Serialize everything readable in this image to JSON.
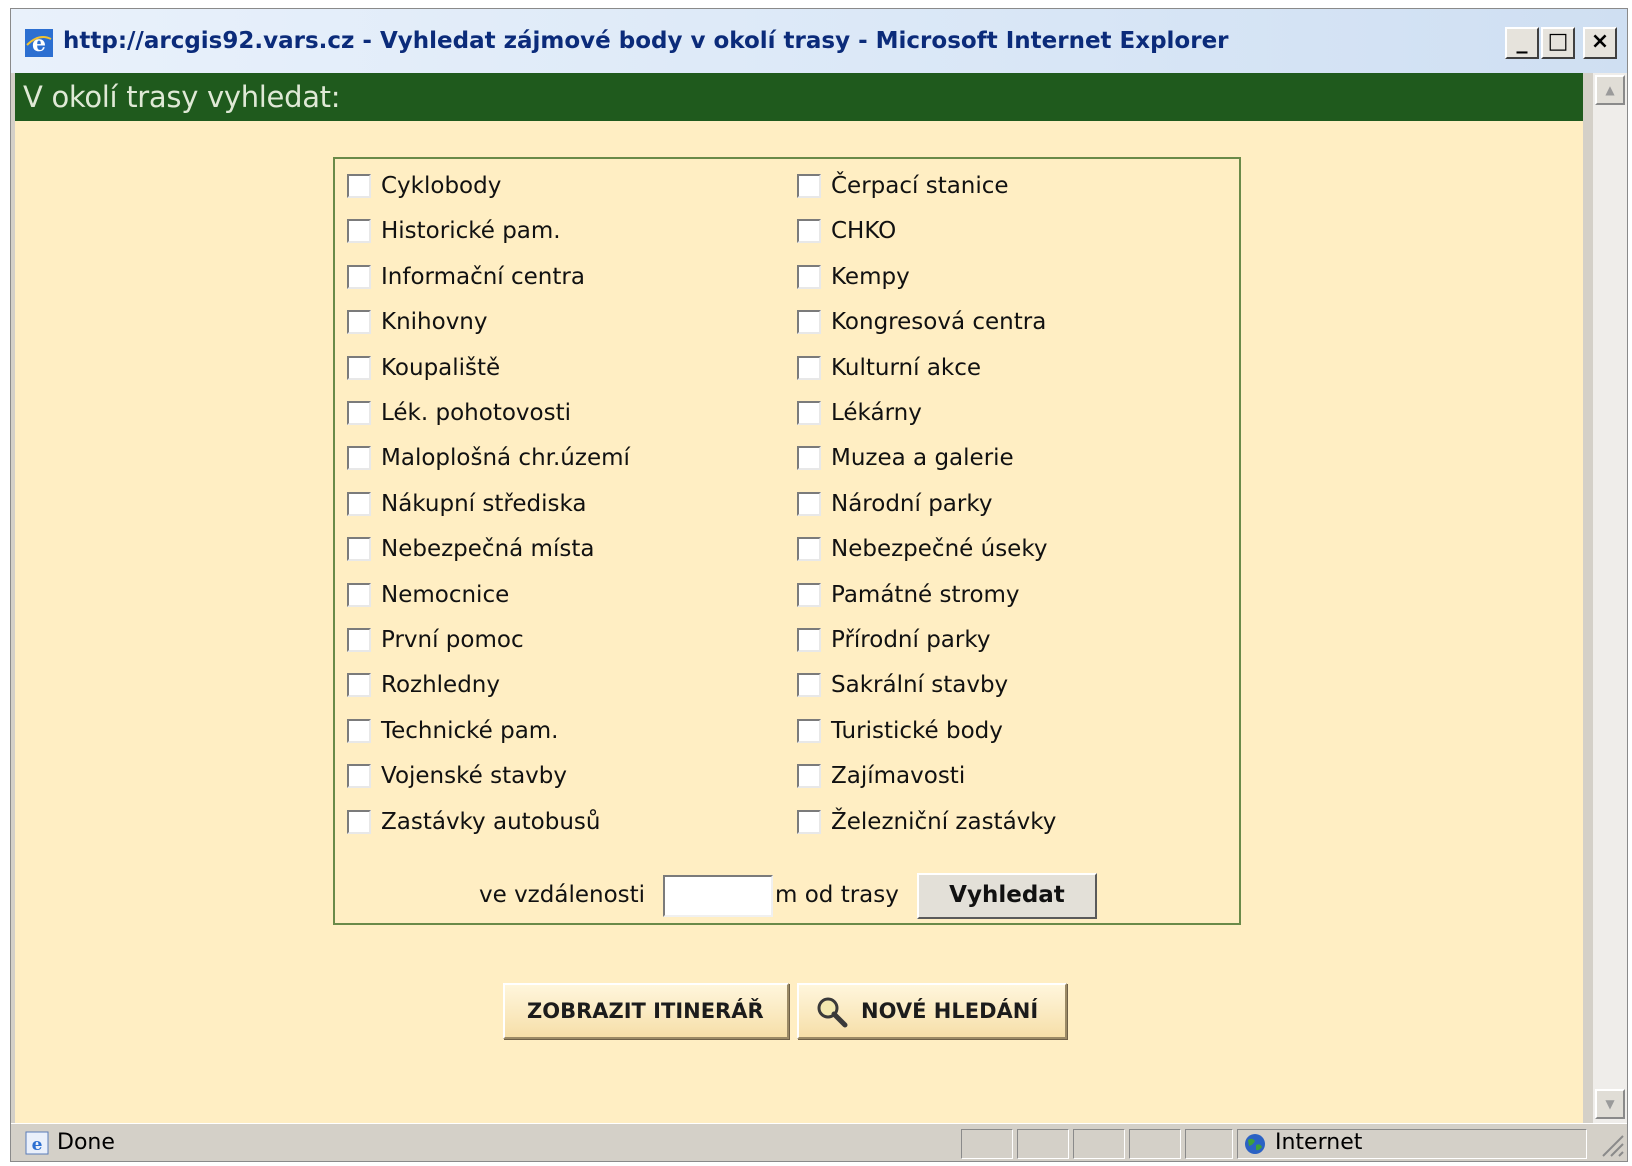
{
  "window": {
    "title": "http://arcgis92.vars.cz - Vyhledat zájmové body v okolí trasy - Microsoft Internet Explorer",
    "minimize_glyph": "_",
    "maximize_glyph": "□",
    "close_glyph": "×"
  },
  "page": {
    "heading": "V okolí trasy vyhledat:",
    "left_column": [
      "Cyklobody",
      "Historické pam.",
      "Informační centra",
      "Knihovny",
      "Koupaliště",
      "Lék. pohotovosti",
      "Maloplošná chr.území",
      "Nákupní střediska",
      "Nebezpečná místa",
      "Nemocnice",
      "První pomoc",
      "Rozhledny",
      "Technické pam.",
      "Vojenské stavby",
      "Zastávky autobusů"
    ],
    "right_column": [
      "Čerpací stanice",
      "CHKO",
      "Kempy",
      "Kongresová centra",
      "Kulturní akce",
      "Lékárny",
      "Muzea a galerie",
      "Národní parky",
      "Nebezpečné úseky",
      "Památné stromy",
      "Přírodní parky",
      "Sakrální stavby",
      "Turistické body",
      "Zajímavosti",
      "Železniční zastávky"
    ],
    "distance": {
      "label_before": "ve vzdálenosti",
      "value": "",
      "label_after": "m od trasy",
      "search_button": "Vyhledat"
    },
    "buttons": {
      "itinerary": "ZOBRAZIT ITINERÁŘ",
      "new_search": "NOVÉ HLEDÁNÍ",
      "new_search_icon": "magnifier-icon"
    }
  },
  "statusbar": {
    "text": "Done",
    "zone": "Internet"
  },
  "colors": {
    "header_strip": "#1f5a1d",
    "content_bg": "#ffeec3",
    "panel_border": "#6a8a49",
    "title_text": "#0b2b7a"
  }
}
